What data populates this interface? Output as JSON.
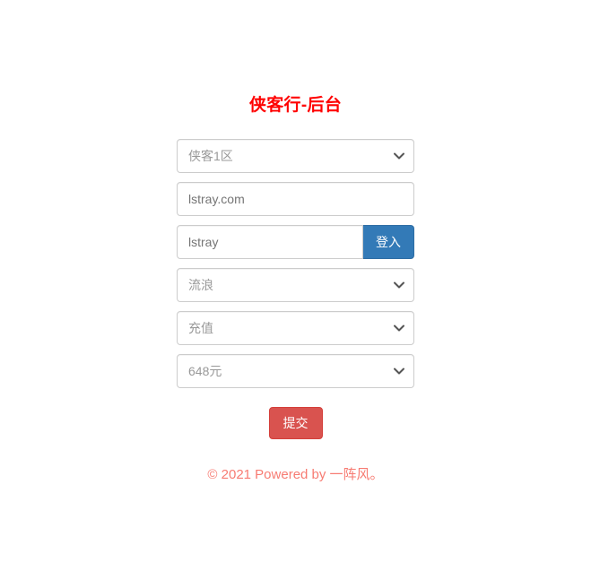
{
  "page": {
    "title": "侠客行-后台",
    "title_color": "#ff0000",
    "background": "#ffffff"
  },
  "form": {
    "server_select": {
      "value": "侠客1区",
      "icon": "chevron-down-icon"
    },
    "site_input": {
      "value": "lstray.com",
      "placeholder": "lstray.com"
    },
    "account_group": {
      "input_value": "lstray",
      "input_placeholder": "lstray",
      "login_label": "登入",
      "login_color": "#337ab7"
    },
    "character_select": {
      "value": "流浪",
      "icon": "chevron-down-icon"
    },
    "action_select": {
      "value": "充值",
      "icon": "chevron-down-icon"
    },
    "amount_select": {
      "value": "648元",
      "icon": "chevron-down-icon"
    },
    "submit": {
      "label": "提交",
      "color": "#d9534f"
    }
  },
  "footer": {
    "text": "© 2021 Powered by 一阵风。",
    "color": "#f77b72"
  }
}
